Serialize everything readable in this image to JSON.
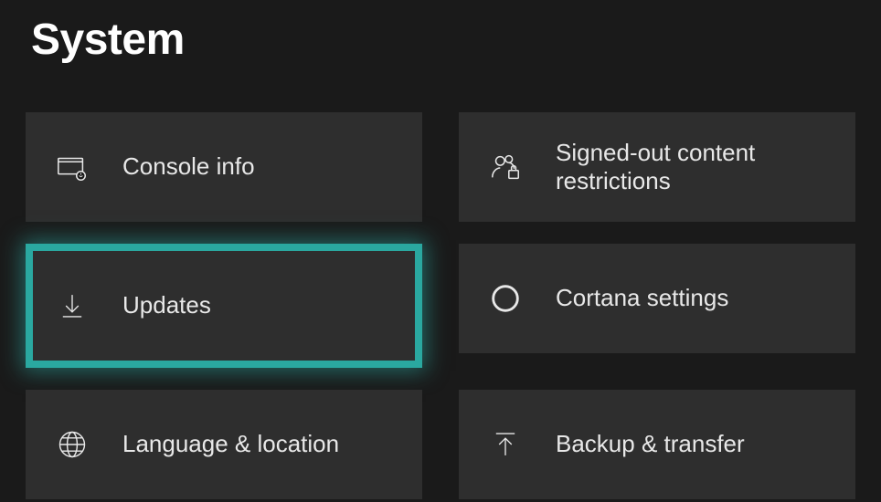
{
  "page_title": "System",
  "tiles": {
    "console_info": {
      "label": "Console info",
      "icon": "console-info-icon"
    },
    "signed_out_restrictions": {
      "label": "Signed-out content restrictions",
      "icon": "people-lock-icon"
    },
    "updates": {
      "label": "Updates",
      "icon": "download-arrow-icon"
    },
    "cortana_settings": {
      "label": "Cortana settings",
      "icon": "circle-ring-icon"
    },
    "language_location": {
      "label": "Language & location",
      "icon": "globe-icon"
    },
    "backup_transfer": {
      "label": "Backup & transfer",
      "icon": "upload-arrow-icon"
    }
  },
  "highlight_color": "#2aa8a0"
}
